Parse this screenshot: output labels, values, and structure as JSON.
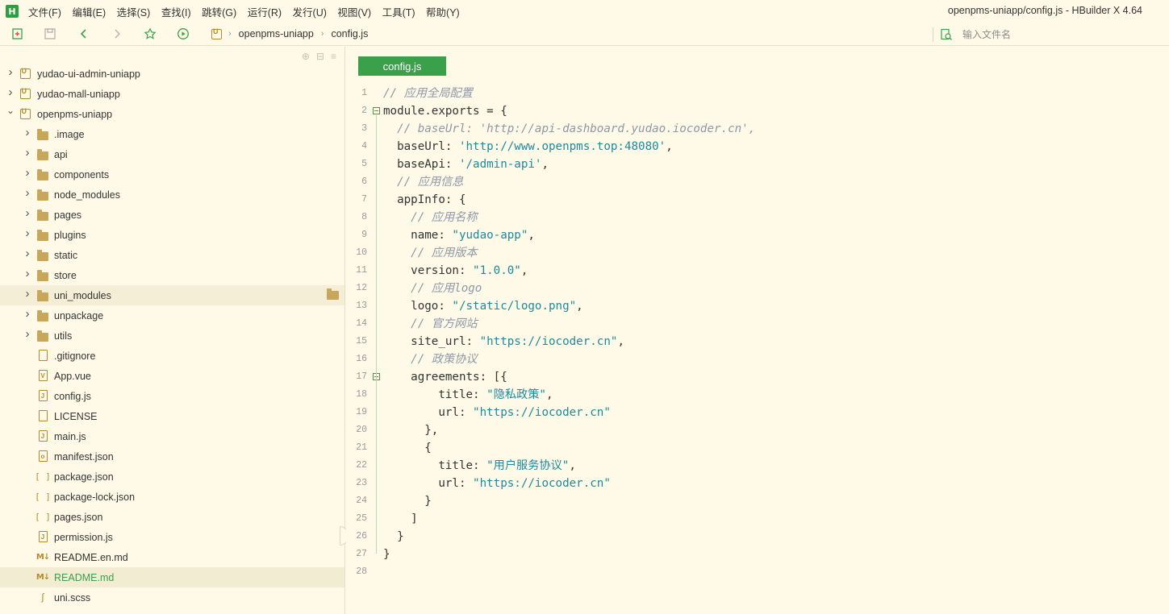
{
  "menubar": {
    "items": [
      "文件(F)",
      "编辑(E)",
      "选择(S)",
      "查找(I)",
      "跳转(G)",
      "运行(R)",
      "发行(U)",
      "视图(V)",
      "工具(T)",
      "帮助(Y)"
    ],
    "window_title": "openpms-uniapp/config.js - HBuilder X 4.64"
  },
  "toolbar": {
    "breadcrumb": [
      "openpms-uniapp",
      "config.js"
    ],
    "search_placeholder": "输入文件名"
  },
  "sidebar": {
    "items": [
      {
        "label": "yudao-ui-admin-uniapp",
        "type": "project",
        "expanded": false
      },
      {
        "label": "yudao-mall-uniapp",
        "type": "project",
        "expanded": false
      },
      {
        "label": "openpms-uniapp",
        "type": "project",
        "expanded": true
      },
      {
        "label": ".image",
        "type": "folder"
      },
      {
        "label": "api",
        "type": "folder"
      },
      {
        "label": "components",
        "type": "folder"
      },
      {
        "label": "node_modules",
        "type": "folder"
      },
      {
        "label": "pages",
        "type": "folder"
      },
      {
        "label": "plugins",
        "type": "folder"
      },
      {
        "label": "static",
        "type": "folder"
      },
      {
        "label": "store",
        "type": "folder"
      },
      {
        "label": "uni_modules",
        "type": "folder"
      },
      {
        "label": "unpackage",
        "type": "folder"
      },
      {
        "label": "utils",
        "type": "folder"
      },
      {
        "label": ".gitignore",
        "type": "file"
      },
      {
        "label": "App.vue",
        "type": "vue"
      },
      {
        "label": "config.js",
        "type": "js"
      },
      {
        "label": "LICENSE",
        "type": "file"
      },
      {
        "label": "main.js",
        "type": "js"
      },
      {
        "label": "manifest.json",
        "type": "manifest"
      },
      {
        "label": "package.json",
        "type": "json"
      },
      {
        "label": "package-lock.json",
        "type": "json"
      },
      {
        "label": "pages.json",
        "type": "json"
      },
      {
        "label": "permission.js",
        "type": "js"
      },
      {
        "label": "README.en.md",
        "type": "md"
      },
      {
        "label": "README.md",
        "type": "md"
      },
      {
        "label": "uni.scss",
        "type": "scss"
      }
    ]
  },
  "editor": {
    "tab_label": "config.js",
    "lines": [
      {
        "n": "1",
        "html": "<span class=\"c-comment\">// 应用全局配置</span>"
      },
      {
        "n": "2",
        "html": "module.exports = {"
      },
      {
        "n": "3",
        "html": "  <span class=\"c-comment\">// baseUrl: 'http://api-dashboard.yudao.iocoder.cn',</span>"
      },
      {
        "n": "4",
        "html": "  baseUrl: <span class=\"c-str\">'http://www.openpms.top:48080'</span>,"
      },
      {
        "n": "5",
        "html": "  baseApi: <span class=\"c-str\">'/admin-api'</span>,"
      },
      {
        "n": "6",
        "html": "  <span class=\"c-comment\">// 应用信息</span>"
      },
      {
        "n": "7",
        "html": "  appInfo: {"
      },
      {
        "n": "8",
        "html": "    <span class=\"c-comment\">// 应用名称</span>"
      },
      {
        "n": "9",
        "html": "    name: <span class=\"c-str\">\"yudao-app\"</span>,"
      },
      {
        "n": "10",
        "html": "    <span class=\"c-comment\">// 应用版本</span>"
      },
      {
        "n": "11",
        "html": "    version: <span class=\"c-str\">\"1.0.0\"</span>,"
      },
      {
        "n": "12",
        "html": "    <span class=\"c-comment\">// 应用logo</span>"
      },
      {
        "n": "13",
        "html": "    logo: <span class=\"c-str\">\"/static/logo.png\"</span>,"
      },
      {
        "n": "14",
        "html": "    <span class=\"c-comment\">// 官方网站</span>"
      },
      {
        "n": "15",
        "html": "    site_url: <span class=\"c-str\">\"https://iocoder.cn\"</span>,"
      },
      {
        "n": "16",
        "html": "    <span class=\"c-comment\">// 政策协议</span>"
      },
      {
        "n": "17",
        "html": "    agreements: [{"
      },
      {
        "n": "18",
        "html": "        title: <span class=\"c-str\">\"隐私政策\"</span>,"
      },
      {
        "n": "19",
        "html": "        url: <span class=\"c-str\">\"https://iocoder.cn\"</span>"
      },
      {
        "n": "20",
        "html": "      },"
      },
      {
        "n": "21",
        "html": "      {"
      },
      {
        "n": "22",
        "html": "        title: <span class=\"c-str\">\"用户服务协议\"</span>,"
      },
      {
        "n": "23",
        "html": "        url: <span class=\"c-str\">\"https://iocoder.cn\"</span>"
      },
      {
        "n": "24",
        "html": "      }"
      },
      {
        "n": "25",
        "html": "    ]"
      },
      {
        "n": "26",
        "html": "  }"
      },
      {
        "n": "27",
        "html": "}"
      },
      {
        "n": "28",
        "html": ""
      }
    ]
  },
  "colors": {
    "background": "#fffae8",
    "accent": "#3aa04a",
    "string": "#1c8a9c",
    "comment": "#8e98a8"
  }
}
